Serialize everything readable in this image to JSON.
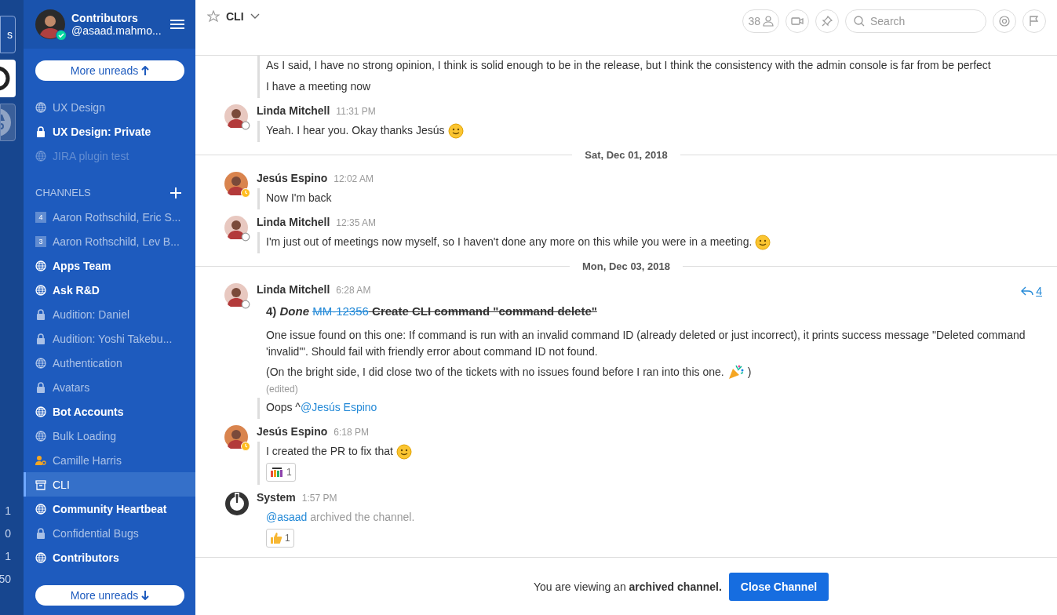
{
  "team_strip": {
    "items": [
      {
        "kind": "text",
        "label": "s"
      },
      {
        "kind": "logo"
      },
      {
        "kind": "spy"
      }
    ],
    "counts": [
      "1",
      "0",
      "1",
      "50"
    ]
  },
  "sidebar": {
    "team": "Contributors",
    "user": "@asaad.mahmo...",
    "online": true,
    "top_items": [
      {
        "kind": "public",
        "label": "UX Design",
        "unread": false,
        "muted": false,
        "selected": false
      },
      {
        "kind": "private",
        "label": "UX Design: Private",
        "unread": true,
        "muted": false,
        "selected": false
      },
      {
        "kind": "public",
        "label": "JIRA plugin test",
        "unread": false,
        "muted": true,
        "selected": false
      }
    ],
    "section": "CHANNELS",
    "channels": [
      {
        "kind": "group",
        "badge": "4",
        "label": "Aaron Rothschild, Eric S...",
        "unread": false,
        "muted": false,
        "selected": false
      },
      {
        "kind": "group",
        "badge": "3",
        "label": "Aaron Rothschild, Lev B...",
        "unread": false,
        "muted": false,
        "selected": false
      },
      {
        "kind": "public",
        "label": "Apps Team",
        "unread": true,
        "muted": false,
        "selected": false
      },
      {
        "kind": "public",
        "label": "Ask R&D",
        "unread": true,
        "muted": false,
        "selected": false
      },
      {
        "kind": "private",
        "label": "Audition: Daniel",
        "unread": false,
        "muted": false,
        "selected": false
      },
      {
        "kind": "private",
        "label": "Audition: Yoshi Takebu...",
        "unread": false,
        "muted": false,
        "selected": false
      },
      {
        "kind": "public",
        "label": "Authentication",
        "unread": false,
        "muted": false,
        "selected": false
      },
      {
        "kind": "private",
        "label": "Avatars",
        "unread": false,
        "muted": false,
        "selected": false
      },
      {
        "kind": "public",
        "label": "Bot Accounts",
        "unread": true,
        "muted": false,
        "selected": false
      },
      {
        "kind": "public",
        "label": "Bulk Loading",
        "unread": false,
        "muted": false,
        "selected": false
      },
      {
        "kind": "dm",
        "label": "Camille Harris",
        "unread": false,
        "muted": false,
        "selected": false
      },
      {
        "kind": "archived",
        "label": "CLI",
        "unread": false,
        "muted": false,
        "selected": true
      },
      {
        "kind": "public",
        "label": "Community Heartbeat",
        "unread": true,
        "muted": false,
        "selected": false
      },
      {
        "kind": "private",
        "label": "Confidential Bugs",
        "unread": false,
        "muted": false,
        "selected": false
      },
      {
        "kind": "public",
        "label": "Contributors",
        "unread": true,
        "muted": false,
        "selected": false
      }
    ],
    "more_unreads_top": "More unreads",
    "more_unreads_bottom": "More unreads"
  },
  "header": {
    "channel": "CLI",
    "members": "38",
    "search": {
      "placeholder": "Search"
    }
  },
  "messages": [
    {
      "kind": "continuation",
      "threaded": true,
      "text": "As I said, I have no strong opinion, I think is solid enough to be in the release, but I think the consistency with the admin console is far from be perfect"
    },
    {
      "kind": "continuation",
      "threaded": true,
      "text": "I have a meeting now"
    },
    {
      "kind": "post",
      "author": "Linda Mitchell",
      "time": "11:31 PM",
      "away": false,
      "threaded": true,
      "blocks": [
        {
          "kind": "text",
          "text": "Yeah. I hear you. Okay thanks Jesús",
          "icons": [
            {
              "kind": "smile"
            }
          ]
        }
      ]
    },
    {
      "kind": "date",
      "label": "Sat, Dec 01, 2018"
    },
    {
      "kind": "post",
      "author": "Jesús Espino",
      "time": "12:02 AM",
      "away": true,
      "threaded": true,
      "blocks": [
        {
          "kind": "text",
          "text": "Now I'm back"
        }
      ]
    },
    {
      "kind": "post",
      "author": "Linda Mitchell",
      "time": "12:35 AM",
      "away": false,
      "threaded": true,
      "blocks": [
        {
          "kind": "text",
          "text": "I'm just out of meetings now myself, so I haven't done any more on this while you were in a meeting.",
          "icons": [
            {
              "kind": "smile"
            }
          ]
        }
      ]
    },
    {
      "kind": "date",
      "label": "Mon, Dec 03, 2018"
    },
    {
      "kind": "post",
      "author": "Linda Mitchell",
      "time": "6:28 AM",
      "away": false,
      "threaded": false,
      "replies": "4",
      "blocks": [
        {
          "kind": "heading",
          "prefix": "4)",
          "state": "Done",
          "link": "MM-12356",
          "title": "Create CLI command \"command delete\""
        },
        {
          "kind": "text",
          "text": "One issue found on this one: If command is run with an invalid command ID (already deleted or just incorrect), it prints success message \"Deleted command 'invalid'\". Should fail with friendly error about command ID not found."
        },
        {
          "kind": "text",
          "text": "(On the bright side, I did close two of the tickets with no issues found before I ran into this one.",
          "icons": [
            {
              "kind": "party"
            }
          ],
          "after": ")"
        },
        {
          "kind": "edited",
          "text": "(edited)"
        }
      ]
    },
    {
      "kind": "continuation",
      "threaded": true,
      "text": "Oops ^",
      "mention": "@Jesús Espino"
    },
    {
      "kind": "post",
      "author": "Jesús Espino",
      "time": "6:18 PM",
      "away": true,
      "threaded": true,
      "blocks": [
        {
          "kind": "text",
          "text": "I created the PR to fix that",
          "icons": [
            {
              "kind": "smile"
            }
          ]
        }
      ],
      "reactions": [
        {
          "kind": "team",
          "count": "1"
        }
      ]
    },
    {
      "kind": "system",
      "author": "System",
      "time": "1:57 PM",
      "threaded": false,
      "blocks": [
        {
          "kind": "system",
          "mention": "@asaad",
          "text": "archived the channel."
        }
      ],
      "reactions": [
        {
          "kind": "thumbs",
          "count": "1"
        }
      ]
    }
  ],
  "footer": {
    "notice": "You are viewing an **archived channel.**",
    "button": "Close Channel"
  }
}
